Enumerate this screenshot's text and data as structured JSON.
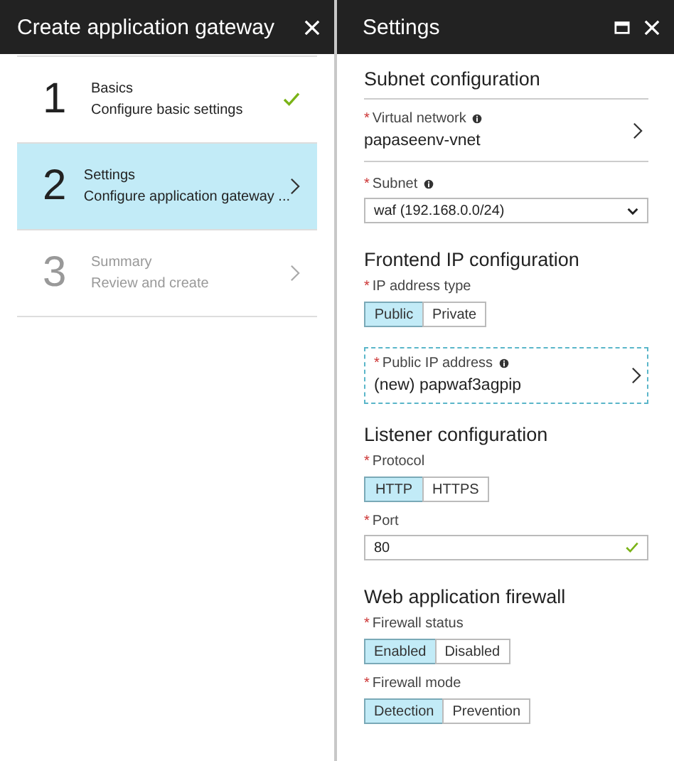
{
  "wizard": {
    "title": "Create application gateway",
    "steps": [
      {
        "number": "1",
        "title": "Basics",
        "subtitle": "Configure basic settings",
        "selected": false,
        "disabled": false,
        "completed": true
      },
      {
        "number": "2",
        "title": "Settings",
        "subtitle": "Configure application gateway ...",
        "selected": true,
        "disabled": false,
        "completed": false
      },
      {
        "number": "3",
        "title": "Summary",
        "subtitle": "Review and create",
        "selected": false,
        "disabled": true,
        "completed": false
      }
    ]
  },
  "settings": {
    "title": "Settings",
    "sections": [
      {
        "heading": "Subnet configuration",
        "divider": true,
        "fields": [
          {
            "kind": "blade-link",
            "mark": "*",
            "label": "Virtual network",
            "info": true,
            "value": "papaseenv-vnet"
          },
          {
            "kind": "select",
            "mark": "*",
            "label": "Subnet",
            "info": true,
            "value": "waf (192.168.0.0/24)"
          }
        ]
      },
      {
        "heading": "Frontend IP configuration",
        "divider": false,
        "fields": [
          {
            "kind": "segmented",
            "mark": "*",
            "label": "IP address type",
            "info": false,
            "options": [
              {
                "label": "Public",
                "selected": true
              },
              {
                "label": "Private",
                "selected": false
              }
            ]
          },
          {
            "kind": "link-box",
            "mark": "*",
            "label": "Public IP address",
            "info": true,
            "value": "(new) papwaf3agpip"
          }
        ]
      },
      {
        "heading": "Listener configuration",
        "divider": false,
        "fields": [
          {
            "kind": "segmented",
            "mark": "*",
            "label": "Protocol",
            "info": false,
            "options": [
              {
                "label": "HTTP",
                "selected": true
              },
              {
                "label": "HTTPS",
                "selected": false
              }
            ]
          },
          {
            "kind": "text-input",
            "mark": "*",
            "label": "Port",
            "info": false,
            "value": "80",
            "valid": true
          }
        ]
      },
      {
        "heading": "Web application firewall",
        "divider": false,
        "fields": [
          {
            "kind": "segmented",
            "mark": "*",
            "label": "Firewall status",
            "info": false,
            "options": [
              {
                "label": "Enabled",
                "selected": true
              },
              {
                "label": "Disabled",
                "selected": false
              }
            ]
          },
          {
            "kind": "segmented",
            "mark": "*",
            "label": "Firewall mode",
            "info": false,
            "options": [
              {
                "label": "Detection",
                "selected": true
              },
              {
                "label": "Prevention",
                "selected": false
              }
            ]
          }
        ]
      }
    ]
  }
}
